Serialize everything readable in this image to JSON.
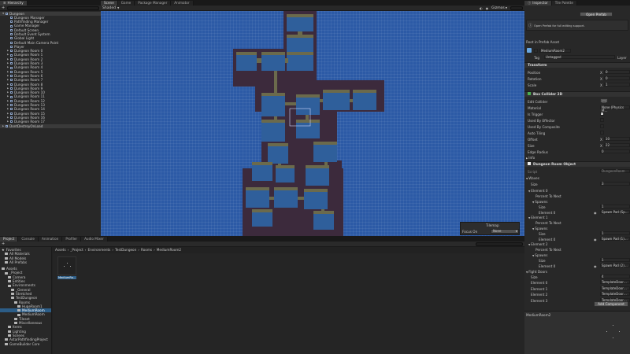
{
  "hierarchy": {
    "tab": "Hierarchy",
    "root": "Dungeon",
    "items": [
      "Dungeon Manager",
      "Pathfinding Manager",
      "Game Manager",
      "Default Screen",
      "Default Event System",
      "Global Light",
      "Default Main Camera Point",
      "Player",
      "Dungeon Room 0",
      "Dungeon Room 1",
      "Dungeon Room 2",
      "Dungeon Room 3",
      "Dungeon Room 4",
      "Dungeon Room 5",
      "Dungeon Room 6",
      "Dungeon Room 7",
      "Dungeon Room 8",
      "Dungeon Room 9",
      "Dungeon Room 10",
      "Dungeon Room 11",
      "Dungeon Room 12",
      "Dungeon Room 13",
      "Dungeon Room 14",
      "Dungeon Room 15",
      "Dungeon Room 16",
      "Dungeon Room 17"
    ],
    "dont_destroy": "DontDestroyOnLoad"
  },
  "scene": {
    "tabs": [
      "Scene",
      "Game",
      "Package Manager",
      "Animator"
    ],
    "shading": "Shaded",
    "gizmos": "Gizmos",
    "tilemap_title": "Tilemap",
    "focus_label": "Focus On",
    "focus_value": "None"
  },
  "inspector": {
    "tabs": [
      "Inspector",
      "Tile Palette"
    ],
    "open_prefab": "Open Prefab",
    "prefab_note": "Open Prefab for full editing support.",
    "root_label": "Root in Prefab Asset",
    "object_name": "MediumRoom2",
    "tag_label": "Tag",
    "tag_value": "Untagged",
    "layer_label": "Layer",
    "transform": "Transform",
    "position": "Position",
    "rotation": "Rotation",
    "scale": "Scale",
    "x": "X",
    "pos_x": "0",
    "rot_x": "0",
    "scale_x": "1",
    "box_collider": "Box Collider 2D",
    "edit_collider": "Edit Collider",
    "material": "Material",
    "material_value": "None (Physics M…",
    "is_trigger": "Is Trigger",
    "used_by_effector": "Used By Effector",
    "used_by_composite": "Used By Composite",
    "auto_tiling": "Auto Tiling",
    "offset": "Offset",
    "offset_x": "10",
    "size": "Size",
    "size_x": "22",
    "edge_radius": "Edge Radius",
    "edge_radius_value": "0",
    "info": "Info",
    "dungeon_room": "Dungeon Room Object",
    "script": "Script",
    "script_value": "DungeonRoom",
    "waves": "Waves",
    "waves_size": "3",
    "elements": [
      {
        "name": "Element 0",
        "percent": "Percent To Next",
        "spawns": "Spawns",
        "size": "Size",
        "size_value": "1",
        "el": "Element 0",
        "value": "Spawn Pad (Sp…"
      },
      {
        "name": "Element 1",
        "percent": "Percent To Next",
        "spawns": "Spawns",
        "size": "Size",
        "size_value": "1",
        "el": "Element 0",
        "value": "Spawn Pad (1)…"
      },
      {
        "name": "Element 2",
        "percent": "Percent To Next",
        "spawns": "Spawns",
        "size": "Size",
        "size_value": "1",
        "el": "Element 0",
        "value": "Spawn Pad (2)…"
      }
    ],
    "fight_doors": "Fight Doors",
    "fight_size": "4",
    "doors": [
      {
        "label": "Element 0",
        "value": "TemplateDoor…"
      },
      {
        "label": "Element 1",
        "value": "TemplateDoor…"
      },
      {
        "label": "Element 2",
        "value": "TemplateDoor…"
      },
      {
        "label": "Element 3",
        "value": "TemplateDoor…"
      }
    ],
    "add_component": "Add Component",
    "preview_title": "MediumRoom2"
  },
  "project": {
    "tabs": [
      "Project",
      "Console",
      "Animation",
      "Profiler",
      "Audio Mixer"
    ],
    "favorites": "Favorites",
    "fav_items": [
      "All Materials",
      "All Models",
      "All Prefabs"
    ],
    "assets": "Assets",
    "tree": [
      {
        "label": "_Project",
        "depth": 1
      },
      {
        "label": "Camera",
        "depth": 2
      },
      {
        "label": "Entities",
        "depth": 2
      },
      {
        "label": "Environments",
        "depth": 2
      },
      {
        "label": "_General",
        "depth": 3
      },
      {
        "label": "Stretched",
        "depth": 3
      },
      {
        "label": "TestDungeon",
        "depth": 3
      },
      {
        "label": "Rooms",
        "depth": 4
      },
      {
        "label": "HugeRoom1",
        "depth": 5
      },
      {
        "label": "MediumRoom",
        "depth": 5
      },
      {
        "label": "MediumRoom",
        "depth": 5
      },
      {
        "label": "Tileset",
        "depth": 4
      },
      {
        "label": "Miscellaneous",
        "depth": 4
      },
      {
        "label": "Items",
        "depth": 2
      },
      {
        "label": "Lighting",
        "depth": 2
      },
      {
        "label": "Scenes",
        "depth": 2
      },
      {
        "label": "AstarPathfindingProject",
        "depth": 1
      },
      {
        "label": "GameBuilder Core",
        "depth": 1
      }
    ],
    "breadcrumb": [
      "Assets",
      "_Project",
      "Environments",
      "TestDungeon",
      "Rooms",
      "MediumRoom2"
    ],
    "asset_name": "MediumRo…"
  },
  "colors": {
    "scene_bg": "#2c5aa6",
    "room_border": "#3c2a3c",
    "room_floor": "#2f5f9b",
    "room_wall": "#6b6a4c",
    "selection": "#2c5d87"
  }
}
